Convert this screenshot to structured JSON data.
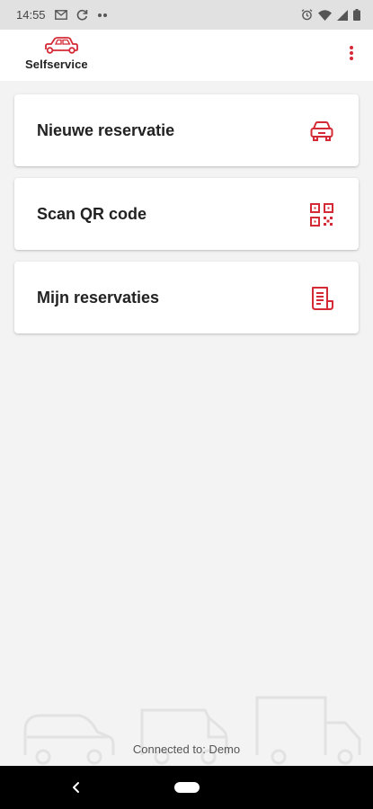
{
  "status_bar": {
    "time": "14:55",
    "left_icons": [
      "gmail-icon",
      "sync-icon",
      "more-notifications-icon"
    ],
    "right_icons": [
      "alarm-icon",
      "wifi-icon",
      "signal-icon",
      "battery-icon"
    ]
  },
  "app_bar": {
    "logo_text": "Selfservice",
    "logo_icon": "car-icon",
    "menu_icon": "more-vert-icon"
  },
  "menu_cards": [
    {
      "label": "Nieuwe reservatie",
      "icon": "car-icon"
    },
    {
      "label": "Scan QR code",
      "icon": "qr-code-icon"
    },
    {
      "label": "Mijn reservaties",
      "icon": "document-icon"
    }
  ],
  "footer": {
    "connection_text": "Connected to: Demo"
  },
  "colors": {
    "accent": "#d42a36",
    "background": "#f3f3f3",
    "card": "#ffffff",
    "status_bar": "#e1e1e1",
    "nav_bar": "#000000"
  }
}
